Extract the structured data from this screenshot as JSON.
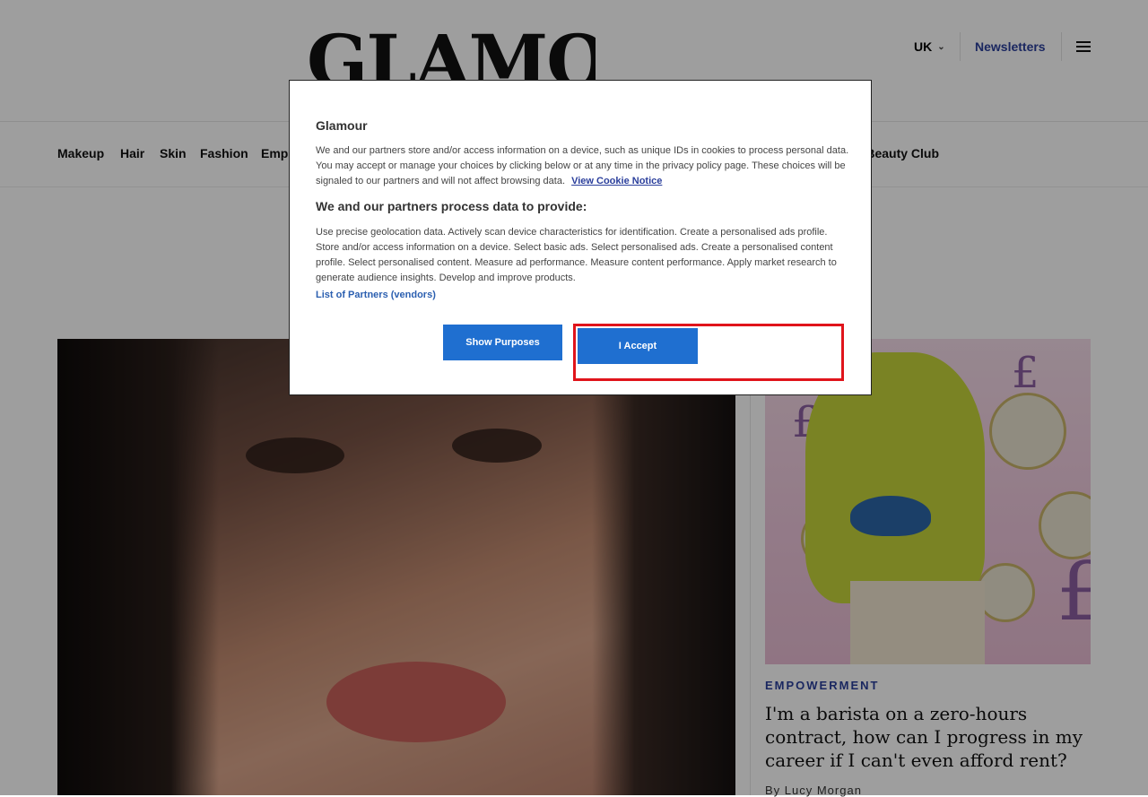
{
  "header": {
    "logo": "GLAMOUR",
    "region": "UK",
    "newsletters": "Newsletters"
  },
  "nav": {
    "items": [
      "Makeup",
      "Hair",
      "Skin",
      "Fashion",
      "Emp",
      "r Beauty Club"
    ]
  },
  "article": {
    "kicker": "EMPOWERMENT",
    "headline": "I'm a barista on a zero-hours contract, how can I progress in my career if I can't even afford rent?",
    "byline": "By Lucy Morgan"
  },
  "cookie_dialog": {
    "title": "Glamour",
    "intro": "We and our partners store and/or access information on a device, such as unique IDs in cookies to process personal data. You may accept or manage your choices by clicking below or at any time in the privacy policy page. These choices will be signaled to our partners and will not affect browsing data.",
    "cookie_notice_link": "View Cookie Notice",
    "subtitle": "We and our partners process data to provide:",
    "purposes": "Use precise geolocation data. Actively scan device characteristics for identification. Create a personalised ads profile. Store and/or access information on a device. Select basic ads. Select personalised ads. Create a personalised content profile. Select personalised content. Measure ad performance. Measure content performance. Apply market research to generate audience insights. Develop and improve products.",
    "partners_link": "List of Partners (vendors)",
    "show_purposes_button": "Show Purposes",
    "accept_button": "I Accept"
  },
  "colors": {
    "accent": "#2b3f9c",
    "button": "#1f6fd0",
    "highlight": "#e0141b"
  }
}
